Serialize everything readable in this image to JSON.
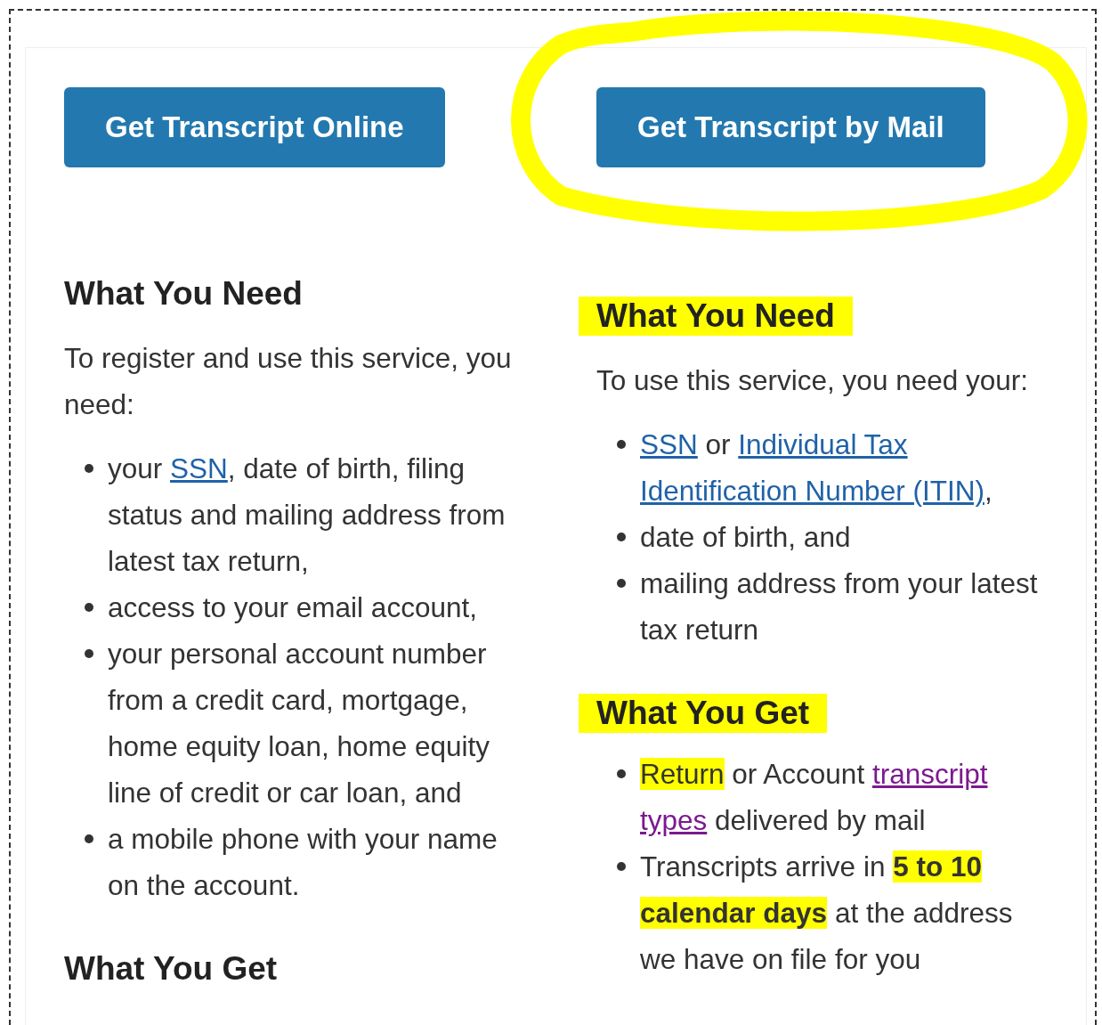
{
  "columns": [
    {
      "button": {
        "label": "Get Transcript Online",
        "circled": false
      },
      "sections": [
        {
          "heading": "What You Need",
          "highlighted": false,
          "intro": "To register and use this service, you need:",
          "bullets": [
            [
              {
                "text": "your ",
                "kind": "text",
                "highlighted": false
              },
              {
                "text": "SSN",
                "kind": "link",
                "highlighted": false
              },
              {
                "text": ", date of birth, filing status and mailing address from latest tax return,",
                "kind": "text",
                "highlighted": false
              }
            ],
            [
              {
                "text": "access to your email account,",
                "kind": "text",
                "highlighted": false
              }
            ],
            [
              {
                "text": "your personal account number from a credit card, mortgage, home equity loan, home equity line of credit or car loan, and",
                "kind": "text",
                "highlighted": false
              }
            ],
            [
              {
                "text": "a mobile phone with your name on the account.",
                "kind": "text",
                "highlighted": false
              }
            ]
          ]
        },
        {
          "heading": "What You Get",
          "highlighted": false
        }
      ]
    },
    {
      "button": {
        "label": "Get Transcript by Mail",
        "circled": true
      },
      "sections": [
        {
          "heading": "What You Need",
          "highlighted": true,
          "intro": "To use this service, you need your:",
          "bullets": [
            [
              {
                "text": "SSN",
                "kind": "link",
                "highlighted": false
              },
              {
                "text": " or ",
                "kind": "text",
                "highlighted": false
              },
              {
                "text": "Individual Tax ",
                "kind": "link",
                "highlighted": false
              },
              {
                "text": "Identification Number (ITIN)",
                "kind": "link",
                "highlighted": false
              },
              {
                "text": ",",
                "kind": "text",
                "highlighted": false
              }
            ],
            [
              {
                "text": "date of birth, and",
                "kind": "text",
                "highlighted": false
              }
            ],
            [
              {
                "text": "mailing address from your latest tax return",
                "kind": "text",
                "highlighted": false
              }
            ]
          ]
        },
        {
          "heading": "What You Get",
          "highlighted": true,
          "bullets": [
            [
              {
                "text": "Return",
                "kind": "text",
                "highlighted": true
              },
              {
                "text": " or Account ",
                "kind": "text",
                "highlighted": false
              },
              {
                "text": "transcript ",
                "kind": "visited-link",
                "highlighted": false
              },
              {
                "text": "types",
                "kind": "visited-link",
                "highlighted": false
              },
              {
                "text": " delivered by mail",
                "kind": "text",
                "highlighted": false
              }
            ],
            [
              {
                "text": "Transcripts arrive in ",
                "kind": "text",
                "highlighted": false
              },
              {
                "text": "**5 to 10 calendar days**",
                "kind": "text",
                "highlighted": true
              },
              {
                "text": " at the address we have on file for you",
                "kind": "text",
                "highlighted": false
              }
            ]
          ]
        }
      ]
    }
  ]
}
